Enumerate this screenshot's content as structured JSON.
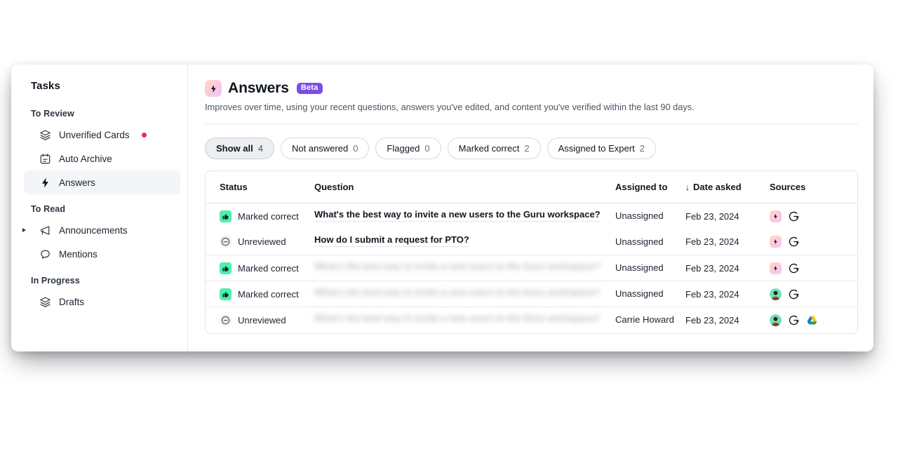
{
  "sidebar": {
    "title": "Tasks",
    "groups": [
      {
        "label": "To Review",
        "items": [
          {
            "label": "Unverified Cards",
            "icon": "layers-icon",
            "badge": true,
            "active": false,
            "caret": false
          },
          {
            "label": "Auto Archive",
            "icon": "calendar-icon",
            "badge": false,
            "active": false,
            "caret": false
          },
          {
            "label": "Answers",
            "icon": "lightning-icon",
            "badge": false,
            "active": true,
            "caret": false
          }
        ]
      },
      {
        "label": "To Read",
        "items": [
          {
            "label": "Announcements",
            "icon": "megaphone-icon",
            "badge": false,
            "active": false,
            "caret": true
          },
          {
            "label": "Mentions",
            "icon": "speech-bubble-icon",
            "badge": false,
            "active": false,
            "caret": false
          }
        ]
      },
      {
        "label": "In Progress",
        "items": [
          {
            "label": "Drafts",
            "icon": "layers-icon",
            "badge": false,
            "active": false,
            "caret": false
          }
        ]
      }
    ]
  },
  "header": {
    "title": "Answers",
    "badge": "Beta",
    "subtitle": "Improves over time, using your recent questions, answers you've edited, and content you've verified within the last 90 days.",
    "icon": "sparkle-lightning-icon"
  },
  "filters": [
    {
      "label": "Show all",
      "count": "4",
      "active": true
    },
    {
      "label": "Not answered",
      "count": "0",
      "active": false
    },
    {
      "label": "Flagged",
      "count": "0",
      "active": false
    },
    {
      "label": "Marked correct",
      "count": "2",
      "active": false
    },
    {
      "label": "Assigned to Expert",
      "count": "2",
      "active": false
    }
  ],
  "table": {
    "columns": {
      "status": "Status",
      "question": "Question",
      "assigned": "Assigned to",
      "date": "Date asked",
      "sources": "Sources",
      "sort_icon": "↓"
    },
    "rows": [
      {
        "status": "Marked correct",
        "status_icon": "thumbs-up-icon",
        "question": "What's the best way to invite a new users to the Guru workspace?",
        "blurred": false,
        "assigned": "Unassigned",
        "date": "Feb 23, 2024",
        "sources": [
          "sparkle-lightning-icon",
          "guru-logo-icon"
        ],
        "separator": false
      },
      {
        "status": "Unreviewed",
        "status_icon": "circle-minus-icon",
        "question": "How do I submit a request for PTO?",
        "blurred": false,
        "assigned": "Unassigned",
        "date": "Feb 23, 2024",
        "sources": [
          "sparkle-lightning-icon",
          "guru-logo-icon"
        ],
        "separator": false
      },
      {
        "status": "Marked correct",
        "status_icon": "thumbs-up-icon",
        "question": "What's the best way to invite a new users to the Guru workspace?",
        "blurred": true,
        "assigned": "Unassigned",
        "date": "Feb 23, 2024",
        "sources": [
          "sparkle-lightning-icon",
          "guru-logo-icon"
        ],
        "separator": true
      },
      {
        "status": "Marked correct",
        "status_icon": "thumbs-up-icon",
        "question": "What's the best way to invite a new users to the Guru workspace?",
        "blurred": true,
        "assigned": "Unassigned",
        "date": "Feb 23, 2024",
        "sources": [
          "user-avatar-icon",
          "guru-logo-icon"
        ],
        "separator": true
      },
      {
        "status": "Unreviewed",
        "status_icon": "circle-minus-icon",
        "question": "What's the best way to invite a new users to the Guru workspace?",
        "blurred": true,
        "assigned": "Carrie Howard",
        "date": "Feb 23, 2024",
        "sources": [
          "user-avatar-icon",
          "guru-logo-icon",
          "google-drive-icon"
        ],
        "separator": true
      }
    ]
  },
  "colors": {
    "accent_purple": "#7c4ce8",
    "status_green": "#4ef0ae",
    "badge_pink": "#f02462",
    "text_primary": "#10161f",
    "text_muted": "#6a7483",
    "border": "#e4e6eb"
  }
}
